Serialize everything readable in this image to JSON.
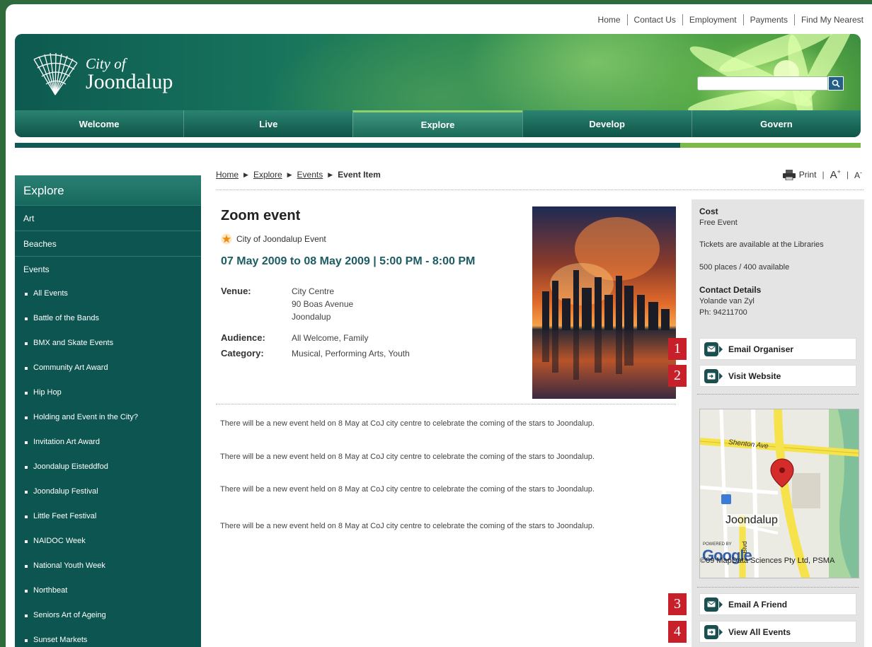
{
  "top_links": [
    "Home",
    "Contact Us",
    "Employment",
    "Payments",
    "Find My Nearest"
  ],
  "logo": {
    "line1": "City of",
    "line2": "Joondalup"
  },
  "search": {
    "placeholder": ""
  },
  "nav": [
    "Welcome",
    "Live",
    "Explore",
    "Develop",
    "Govern"
  ],
  "nav_active": "Explore",
  "sidebar": {
    "title": "Explore",
    "top_items": [
      "Art",
      "Beaches",
      "Events"
    ],
    "sub_items": [
      "All Events",
      "Battle of the Bands",
      "BMX and Skate Events",
      "Community Art Award",
      "Hip Hop",
      "Holding and Event in the City?",
      "Invitation Art Award",
      "Joondalup Eisteddfod",
      "Joondalup Festival",
      "Little Feet Festival",
      "NAIDOC Week",
      "National Youth Week",
      "Northbeat",
      "Seniors Art of Ageing",
      "Sunset Markets"
    ]
  },
  "breadcrumb": [
    "Home",
    "Explore",
    "Events",
    "Event Item"
  ],
  "tools": {
    "print": "Print",
    "increase": "A",
    "increase_sup": "+",
    "decrease": "A",
    "decrease_sup": "-"
  },
  "event": {
    "title": "Zoom event",
    "tag": "City of Joondalup Event",
    "date": "07 May 2009 to 08 May 2009 | 5:00 PM - 8:00 PM",
    "venue_label": "Venue:",
    "venue": [
      "City Centre",
      "90 Boas Avenue",
      "Joondalup"
    ],
    "audience_label": "Audience:",
    "audience": "All Welcome, Family",
    "category_label": "Category:",
    "category": "Musical, Performing Arts, Youth",
    "paragraphs": [
      "There will be a new event held on 8 May at CoJ city centre to celebrate the coming of the stars to Joondalup.",
      "There will be a new event held on 8 May at CoJ city centre to celebrate the coming of the stars to Joondalup.",
      "There will be a new event held on 8 May at CoJ city centre to celebrate the coming of the stars to Joondalup.",
      "There will be a new event held on 8 May at CoJ city centre to celebrate the coming of the stars to Joondalup."
    ]
  },
  "panel": {
    "cost_label": "Cost",
    "cost": "Free Event",
    "tickets": "Tickets are available at the Libraries",
    "places": "500 places / 400 available",
    "contact_label": "Contact Details",
    "contact_name": "Yolande van Zyl",
    "contact_phone": "Ph: 94211700",
    "buttons": [
      "Email Organiser",
      "Visit Website",
      "Email A Friend",
      "View All Events"
    ],
    "badges": [
      "1",
      "2",
      "3",
      "4"
    ]
  },
  "map": {
    "city": "Joondalup",
    "street1": "Shenton Ave",
    "street2": "Blvd",
    "powered": "POWERED BY",
    "google": "Google",
    "copyright": "©09 MapData Sciences Pty Ltd, PSMA"
  },
  "colors": {
    "brand_dark": "#0d5550",
    "accent_green": "#7cb948",
    "badge_red": "#c8202b",
    "date_teal": "#1e5c63"
  }
}
